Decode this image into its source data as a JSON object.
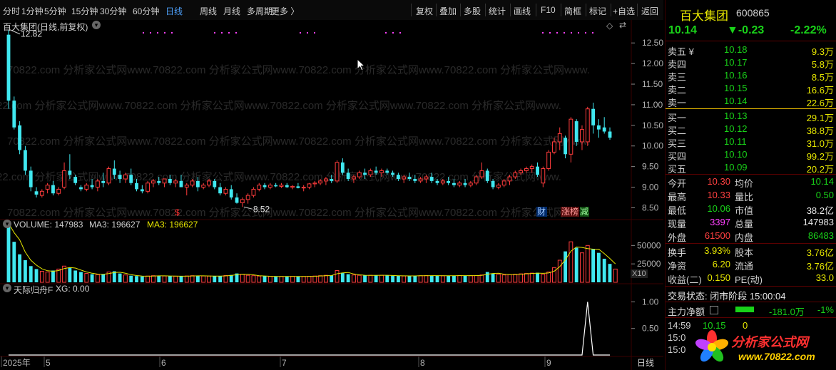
{
  "toolbar": {
    "left": [
      "分时",
      "1分钟",
      "5分钟",
      "15分钟",
      "30分钟",
      "60分钟",
      "日线",
      "周线",
      "月线",
      "多周期",
      "更多 〉"
    ],
    "right": [
      "复权",
      "叠加",
      "多股",
      "统计",
      "画线",
      "F10",
      "简框",
      "标记",
      "+自选",
      "返回"
    ],
    "active": "日线"
  },
  "chart": {
    "title": "百大集团(日线,前复权)",
    "high_label": "12.82",
    "low_label": "8.52",
    "watermark": "70822.com 分析家公式网www.70822.com 分析家公式网www.70822.com 分析家公式网www.70822.com 分析家公式网www.",
    "markers": {
      "dollar": "$",
      "cai": "财",
      "zhangbang": "涨榜",
      "jian": "减"
    },
    "volume_label": "VOLUME: 147983",
    "ma3_label": "MA3: 196627",
    "ma3_label2": "MA3: 196627",
    "volume_unit": "X10",
    "indicator_label": "天际归舟F",
    "indicator_value": "XG: 0.00",
    "bottom_period": "日线",
    "x_labels": [
      "2025年",
      "5",
      "6",
      "7",
      "8",
      "9"
    ],
    "colors": {
      "up": "#ff3c3c",
      "down": "#40e8f0",
      "ma": "#e6e600",
      "grid": "#3a0000"
    }
  },
  "chart_data": [
    {
      "type": "candlestick",
      "title": "百大集团(日线,前复权)",
      "y_ticks": [
        8.5,
        9.0,
        9.5,
        10.0,
        10.5,
        11.0,
        11.5,
        12.0,
        12.5
      ],
      "ylim": [
        8.3,
        12.85
      ],
      "annotations": [
        {
          "text": "12.82",
          "type": "high"
        },
        {
          "text": "8.52",
          "type": "low"
        }
      ],
      "ohlc": [
        [
          12.7,
          12.82,
          10.9,
          11.1
        ],
        [
          11.1,
          11.2,
          10.4,
          10.45
        ],
        [
          10.5,
          10.6,
          9.8,
          9.9
        ],
        [
          9.9,
          10.0,
          9.3,
          9.4
        ],
        [
          9.4,
          9.5,
          8.9,
          9.0
        ],
        [
          8.9,
          9.0,
          8.75,
          8.82
        ],
        [
          8.8,
          8.95,
          8.75,
          8.9
        ],
        [
          8.95,
          9.1,
          8.85,
          9.05
        ],
        [
          9.05,
          9.15,
          8.8,
          8.85
        ],
        [
          8.85,
          9.0,
          8.8,
          8.95
        ],
        [
          9.0,
          9.6,
          8.95,
          9.4
        ],
        [
          9.4,
          9.8,
          9.2,
          9.3
        ],
        [
          9.25,
          9.3,
          9.05,
          9.1
        ],
        [
          9.0,
          9.05,
          8.9,
          8.95
        ],
        [
          8.95,
          9.1,
          8.9,
          9.05
        ],
        [
          9.05,
          9.2,
          8.95,
          9.0
        ],
        [
          9.0,
          9.2,
          8.9,
          9.15
        ],
        [
          9.15,
          9.35,
          9.0,
          9.1
        ],
        [
          9.1,
          9.5,
          9.05,
          9.45
        ],
        [
          9.45,
          9.65,
          9.2,
          9.3
        ],
        [
          9.3,
          9.4,
          9.1,
          9.2
        ],
        [
          9.2,
          9.35,
          9.1,
          9.3
        ],
        [
          9.3,
          9.45,
          9.05,
          9.1
        ],
        [
          9.1,
          9.2,
          8.9,
          8.95
        ],
        [
          8.95,
          9.05,
          8.85,
          8.9
        ],
        [
          8.9,
          9.15,
          8.85,
          9.1
        ],
        [
          9.1,
          9.2,
          9.0,
          9.15
        ],
        [
          9.15,
          9.25,
          9.05,
          9.1
        ],
        [
          9.1,
          9.2,
          9.0,
          9.2
        ],
        [
          9.2,
          9.3,
          9.05,
          9.1
        ],
        [
          9.1,
          9.2,
          9.0,
          9.15
        ],
        [
          9.15,
          9.3,
          9.05,
          9.0
        ],
        [
          9.0,
          9.1,
          8.8,
          9.05
        ],
        [
          9.05,
          9.2,
          9.0,
          9.15
        ],
        [
          9.15,
          9.25,
          8.9,
          9.0
        ],
        [
          9.0,
          9.1,
          8.95,
          9.05
        ],
        [
          9.05,
          9.2,
          9.0,
          9.15
        ],
        [
          9.15,
          9.2,
          8.95,
          9.0
        ],
        [
          9.0,
          9.1,
          8.8,
          8.85
        ],
        [
          8.85,
          9.0,
          8.8,
          8.95
        ],
        [
          8.95,
          9.05,
          8.7,
          8.75
        ],
        [
          8.75,
          8.85,
          8.6,
          8.62
        ],
        [
          8.62,
          8.75,
          8.52,
          8.7
        ],
        [
          8.7,
          8.85,
          8.6,
          8.8
        ],
        [
          8.8,
          9.0,
          8.75,
          8.95
        ],
        [
          8.95,
          9.1,
          8.9,
          9.05
        ],
        [
          9.05,
          9.1,
          8.95,
          9.0
        ],
        [
          9.0,
          9.1,
          8.95,
          9.05
        ],
        [
          9.05,
          9.1,
          9.0,
          9.02
        ],
        [
          9.02,
          9.1,
          8.98,
          9.05
        ],
        [
          9.05,
          9.1,
          8.98,
          9.0
        ],
        [
          9.0,
          9.05,
          8.95,
          9.02
        ],
        [
          9.02,
          9.1,
          8.97,
          8.98
        ],
        [
          8.98,
          9.05,
          8.9,
          9.0
        ],
        [
          9.0,
          9.1,
          8.95,
          9.08
        ],
        [
          9.08,
          9.15,
          9.0,
          9.1
        ],
        [
          9.1,
          9.2,
          9.05,
          9.15
        ],
        [
          9.15,
          9.25,
          9.05,
          9.2
        ],
        [
          9.2,
          9.3,
          9.1,
          9.15
        ],
        [
          9.15,
          9.65,
          9.1,
          9.6
        ],
        [
          9.6,
          9.7,
          9.3,
          9.35
        ],
        [
          9.35,
          9.45,
          9.15,
          9.2
        ],
        [
          9.2,
          9.3,
          9.1,
          9.25
        ],
        [
          9.25,
          9.4,
          9.2,
          9.35
        ],
        [
          9.35,
          9.45,
          9.2,
          9.3
        ],
        [
          9.3,
          9.45,
          9.25,
          9.4
        ],
        [
          9.4,
          9.5,
          9.3,
          9.35
        ],
        [
          9.35,
          9.45,
          9.25,
          9.4
        ],
        [
          9.4,
          9.45,
          9.3,
          9.35
        ],
        [
          9.35,
          9.4,
          9.25,
          9.3
        ],
        [
          9.3,
          9.35,
          9.15,
          9.2
        ],
        [
          9.2,
          9.3,
          9.1,
          9.25
        ],
        [
          9.25,
          9.35,
          9.15,
          9.2
        ],
        [
          9.2,
          9.3,
          9.1,
          9.15
        ],
        [
          9.15,
          9.25,
          9.1,
          9.2
        ],
        [
          9.2,
          9.3,
          9.1,
          9.25
        ],
        [
          9.25,
          9.35,
          9.1,
          9.15
        ],
        [
          9.15,
          9.2,
          9.05,
          9.1
        ],
        [
          9.1,
          9.2,
          9.05,
          9.15
        ],
        [
          9.15,
          9.25,
          9.05,
          9.1
        ],
        [
          9.1,
          9.2,
          9.0,
          9.05
        ],
        [
          9.05,
          9.15,
          9.0,
          9.1
        ],
        [
          9.1,
          9.2,
          9.0,
          9.05
        ],
        [
          9.05,
          9.15,
          9.0,
          9.1
        ],
        [
          9.1,
          9.3,
          9.05,
          9.25
        ],
        [
          9.25,
          9.6,
          9.2,
          9.4
        ],
        [
          9.4,
          9.45,
          9.1,
          9.15
        ],
        [
          9.15,
          9.2,
          8.95,
          9.0
        ],
        [
          9.0,
          9.1,
          8.95,
          9.05
        ],
        [
          9.05,
          9.2,
          9.0,
          9.15
        ],
        [
          9.15,
          9.3,
          9.05,
          9.25
        ],
        [
          9.25,
          9.4,
          9.2,
          9.35
        ],
        [
          9.35,
          9.45,
          9.3,
          9.4
        ],
        [
          9.4,
          9.5,
          9.35,
          9.45
        ],
        [
          9.45,
          9.55,
          9.35,
          9.5
        ],
        [
          9.5,
          9.6,
          9.25,
          9.3
        ],
        [
          9.1,
          9.5,
          9.0,
          9.45
        ],
        [
          9.45,
          9.9,
          9.4,
          9.85
        ],
        [
          9.85,
          10.2,
          9.8,
          10.1
        ],
        [
          10.1,
          10.45,
          9.9,
          10.3
        ],
        [
          10.2,
          10.25,
          9.7,
          9.8
        ],
        [
          9.8,
          10.7,
          9.6,
          10.65
        ],
        [
          10.6,
          10.65,
          10.0,
          10.1
        ],
        [
          10.1,
          10.5,
          9.9,
          10.4
        ],
        [
          10.1,
          10.95,
          10.0,
          10.9
        ],
        [
          10.9,
          11.05,
          10.3,
          10.5
        ],
        [
          10.5,
          10.65,
          10.2,
          10.4
        ],
        [
          10.45,
          10.7,
          10.3,
          10.35
        ],
        [
          10.35,
          10.45,
          10.15,
          10.2
        ]
      ]
    },
    {
      "type": "bar",
      "title": "VOLUME",
      "y_ticks": [
        25000,
        50000
      ],
      "ylim": [
        0,
        90000
      ],
      "values": [
        80000,
        55000,
        38000,
        30000,
        22000,
        18000,
        15000,
        14000,
        16000,
        18000,
        22000,
        20000,
        16000,
        14000,
        12000,
        11000,
        10500,
        11000,
        14000,
        15000,
        12000,
        10000,
        9000,
        8500,
        8000,
        8500,
        9000,
        8800,
        8600,
        8400,
        8300,
        8200,
        8600,
        9000,
        8800,
        8600,
        8500,
        8400,
        8600,
        9200,
        10000,
        12000,
        11000,
        9500,
        9000,
        8500,
        8200,
        8000,
        7800,
        7900,
        8000,
        8100,
        8000,
        7900,
        8200,
        8500,
        9000,
        9500,
        9200,
        16000,
        13000,
        11000,
        10000,
        9500,
        9200,
        9500,
        9800,
        9500,
        9300,
        9000,
        8800,
        8600,
        8700,
        8900,
        9000,
        9200,
        9100,
        9000,
        8900,
        9000,
        9100,
        9200,
        9100,
        9000,
        9200,
        10000,
        14000,
        12000,
        11000,
        10000,
        10500,
        11000,
        11500,
        12000,
        12500,
        13000,
        11000,
        14000,
        20000,
        30000,
        42000,
        55000,
        47000,
        40000,
        50000,
        45000,
        40000,
        32000,
        25000,
        18000
      ],
      "ma3": [
        80000,
        67500,
        57667,
        41000,
        30000,
        23333,
        18333,
        15667,
        15000,
        16000,
        18667,
        20000,
        19333,
        16667,
        14000,
        12333,
        11167,
        10833,
        11833,
        13333,
        13667,
        12333,
        10333,
        9167,
        8500,
        8333,
        8500,
        8767,
        8800,
        8600,
        8433,
        8300,
        8367,
        8600,
        8800,
        8800,
        8633,
        8500,
        8500,
        8733,
        9267,
        10400,
        11000,
        10833,
        10167,
        9000,
        8567,
        8233,
        8000,
        7900,
        7900,
        8000,
        8033,
        8000,
        8033,
        8200,
        8567,
        9000,
        9233,
        11567,
        12733,
        13333,
        11333,
        10167,
        9567,
        9400,
        9500,
        9600,
        9533,
        9267,
        9033,
        8800,
        8700,
        8733,
        8867,
        9033,
        9100,
        9100,
        9000,
        8967,
        9000,
        9100,
        9133,
        9100,
        9100,
        9400,
        11067,
        12000,
        12333,
        11000,
        10500,
        10500,
        11000,
        11500,
        12000,
        12500,
        12167,
        12667,
        15000,
        21333,
        30667,
        42333,
        48000,
        47333,
        45667,
        45000,
        45000,
        39000,
        32333,
        25000
      ]
    },
    {
      "type": "line",
      "title": "天际归舟F",
      "y_ticks": [
        0.5,
        1.0
      ],
      "ylim": [
        0,
        1.1
      ],
      "series": [
        {
          "name": "XG",
          "spike_at_index": 104,
          "values": "0 except 1.0 at spike_at_index"
        }
      ]
    }
  ],
  "quote": {
    "name": "百大集团",
    "code": "600865",
    "price": "10.14",
    "change": "▼-0.23",
    "pct": "-2.22%",
    "asks": [
      {
        "label": "卖五 ¥",
        "price": "10.18",
        "vol": "9.3万"
      },
      {
        "label": "卖四",
        "price": "10.17",
        "vol": "5.8万"
      },
      {
        "label": "卖三",
        "price": "10.16",
        "vol": "8.5万"
      },
      {
        "label": "卖二",
        "price": "10.15",
        "vol": "16.6万"
      },
      {
        "label": "卖一",
        "price": "10.14",
        "vol": "22.6万"
      }
    ],
    "bids": [
      {
        "label": "买一",
        "price": "10.13",
        "vol": "29.1万"
      },
      {
        "label": "买二",
        "price": "10.12",
        "vol": "38.8万"
      },
      {
        "label": "买三",
        "price": "10.11",
        "vol": "31.0万"
      },
      {
        "label": "买四",
        "price": "10.10",
        "vol": "99.2万"
      },
      {
        "label": "买五",
        "price": "10.09",
        "vol": "20.2万"
      }
    ],
    "stats": [
      {
        "l1": "今开",
        "v1": "10.30",
        "l2": "均价",
        "v2": "10.14",
        "c1": "red",
        "c2": "grn"
      },
      {
        "l1": "最高",
        "v1": "10.33",
        "l2": "量比",
        "v2": "0.50",
        "c1": "red",
        "c2": "grn"
      },
      {
        "l1": "最低",
        "v1": "10.06",
        "l2": "市值",
        "v2": "38.2亿",
        "c1": "grn",
        "c2": "wht"
      },
      {
        "l1": "现量",
        "v1": "3397",
        "l2": "总量",
        "v2": "147983",
        "c1": "mag",
        "c2": "wht"
      },
      {
        "l1": "外盘",
        "v1": "61500",
        "l2": "内盘",
        "v2": "86483",
        "c1": "red",
        "c2": "grn"
      }
    ],
    "stats2": [
      {
        "l1": "换手",
        "v1": "3.93%",
        "l2": "股本",
        "v2": "3.76亿"
      },
      {
        "l1": "净资",
        "v1": "6.20",
        "l2": "流通",
        "v2": "3.76亿"
      },
      {
        "l1": "收益(二)",
        "v1": "0.150",
        "l2": "PE(动)",
        "v2": "33.0"
      }
    ],
    "status_label": "交易状态: 闭市阶段 15:00:04",
    "net_label": "主力净额",
    "net_value": "-181.0万",
    "net_pct": "-1%",
    "ticks": [
      {
        "time": "14:59",
        "price": "10.15",
        "vol": "0"
      },
      {
        "time": "15:0",
        "price": "",
        "vol": ""
      },
      {
        "time": "15:0",
        "price": "",
        "vol": ""
      }
    ],
    "logo_text": "分析家公式网",
    "logo_url": "www.70822.com"
  }
}
